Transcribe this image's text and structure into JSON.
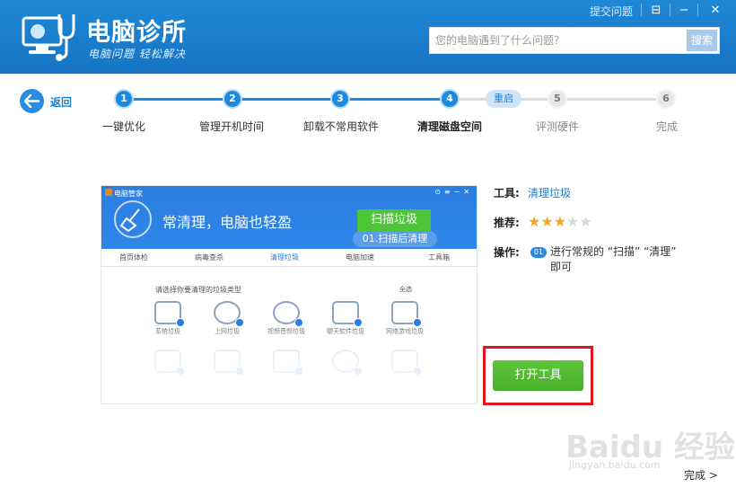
{
  "app": {
    "title": "电脑诊所",
    "slogan": "电脑问题 轻松解决",
    "submit_link": "提交问题"
  },
  "window_controls": {
    "menu": "⊟",
    "minimize": "−",
    "close": "✕"
  },
  "search": {
    "placeholder": "您的电脑遇到了什么问题？",
    "button": "搜索"
  },
  "back": {
    "label": "返回"
  },
  "steps": [
    {
      "number": "1",
      "label": "一键优化",
      "state": "done"
    },
    {
      "number": "2",
      "label": "管理开机时间",
      "state": "done"
    },
    {
      "number": "3",
      "label": "卸载不常用软件",
      "state": "done"
    },
    {
      "number": "4",
      "label": "清理磁盘空间",
      "state": "active"
    },
    {
      "number": "5",
      "label": "评测硬件",
      "state": "todo"
    },
    {
      "number": "6",
      "label": "完成",
      "state": "todo"
    }
  ],
  "restart_tag": "重启",
  "preview": {
    "app_name": "电脑管家",
    "headline": "常清理，电脑也轻盈",
    "scan_button": "扫描垃圾",
    "tooltip": "01.扫描后清理",
    "tabs": [
      "首页体检",
      "病毒查杀",
      "清理垃圾",
      "电脑加速",
      "工具箱"
    ],
    "select_title": "请选择你要清理的垃圾类型",
    "select_all": "全选",
    "items": [
      "系统垃圾",
      "上网垃圾",
      "视频音频垃圾",
      "聊天软件垃圾",
      "网络游戏垃圾"
    ]
  },
  "info": {
    "tool_label": "工具:",
    "tool_name": "清理垃圾",
    "recommend_label": "推荐:",
    "rating": 3,
    "rating_max": 5,
    "operation_label": "操作:",
    "operation_badge": "01",
    "operation_text": "进行常规的 “扫描” “清理” 即可"
  },
  "open_button": "打开工具",
  "watermark": {
    "main": "Baidu 经验",
    "sub": "jingyan.baidu.com"
  },
  "finish_link": "完成 >",
  "colors": {
    "header": "#1a7fd3",
    "accent": "#1a8be0",
    "green": "#4ec538",
    "highlight": "#e4141b",
    "star": "#f5a623"
  }
}
